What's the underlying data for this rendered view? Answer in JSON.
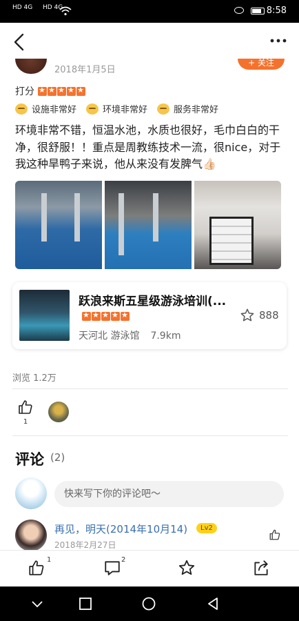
{
  "status_bar": {
    "sim1": "HD 4G",
    "sim2": "HD 4G",
    "time": "8:58"
  },
  "header": {
    "back_icon": "chevron-left-icon",
    "more_icon": "ellipsis-icon"
  },
  "post": {
    "date": "2018年1月5日",
    "follow_label": "+ 关注",
    "rating_label": "打分",
    "rating_value": 5,
    "tags": [
      {
        "icon": "smile-face-icon",
        "label": "设施非常好"
      },
      {
        "icon": "smile-face-icon",
        "label": "环境非常好"
      },
      {
        "icon": "smile-face-icon",
        "label": "服务非常好"
      }
    ],
    "review_text": "环境非常不错，恒温水池，水质也很好，毛巾白白的干净，很舒服！！重点是周教练技术一流，很nice，对于我这种旱鸭子来说，他从来没有发脾气👍🏻",
    "photos": [
      "indoor-pool-photo",
      "indoor-pool-photo",
      "towel-shelf-photo"
    ]
  },
  "venue_card": {
    "title": "跃浪来斯五星级游泳培训(...",
    "rating_value": 5,
    "area": "天河北 游泳馆",
    "distance": "7.9km",
    "fav_count": "888",
    "fav_icon": "star-outline-icon"
  },
  "stats": {
    "views": "浏览 1.2万",
    "like_count": "1"
  },
  "comments": {
    "title": "评论",
    "count": "(2)",
    "input_placeholder": "快来写下你的评论吧～",
    "items": [
      {
        "name": "再见，明天(2014年10月14)",
        "level": "Lv2",
        "date": "2018年2月27日"
      }
    ]
  },
  "bottom_bar": {
    "like_count": "1",
    "comment_count": "2"
  },
  "colors": {
    "accent": "#f5722d",
    "link": "#3a6fb0",
    "level_badge": "#ffd11a"
  }
}
